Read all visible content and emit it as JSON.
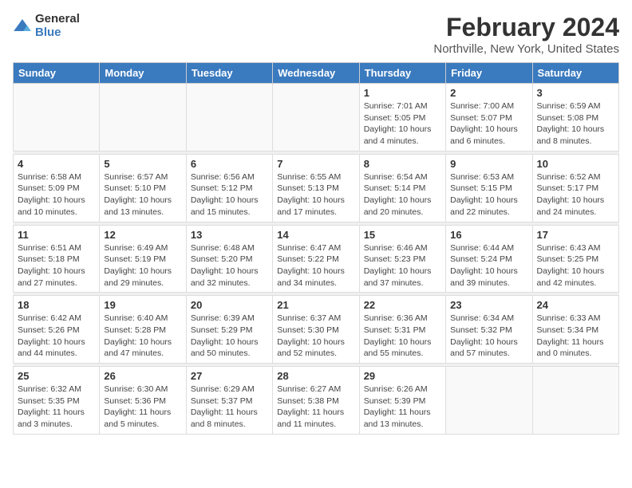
{
  "header": {
    "logo_line1": "General",
    "logo_line2": "Blue",
    "month_title": "February 2024",
    "location": "Northville, New York, United States"
  },
  "weekdays": [
    "Sunday",
    "Monday",
    "Tuesday",
    "Wednesday",
    "Thursday",
    "Friday",
    "Saturday"
  ],
  "weeks": [
    [
      {
        "day": "",
        "info": ""
      },
      {
        "day": "",
        "info": ""
      },
      {
        "day": "",
        "info": ""
      },
      {
        "day": "",
        "info": ""
      },
      {
        "day": "1",
        "info": "Sunrise: 7:01 AM\nSunset: 5:05 PM\nDaylight: 10 hours\nand 4 minutes."
      },
      {
        "day": "2",
        "info": "Sunrise: 7:00 AM\nSunset: 5:07 PM\nDaylight: 10 hours\nand 6 minutes."
      },
      {
        "day": "3",
        "info": "Sunrise: 6:59 AM\nSunset: 5:08 PM\nDaylight: 10 hours\nand 8 minutes."
      }
    ],
    [
      {
        "day": "4",
        "info": "Sunrise: 6:58 AM\nSunset: 5:09 PM\nDaylight: 10 hours\nand 10 minutes."
      },
      {
        "day": "5",
        "info": "Sunrise: 6:57 AM\nSunset: 5:10 PM\nDaylight: 10 hours\nand 13 minutes."
      },
      {
        "day": "6",
        "info": "Sunrise: 6:56 AM\nSunset: 5:12 PM\nDaylight: 10 hours\nand 15 minutes."
      },
      {
        "day": "7",
        "info": "Sunrise: 6:55 AM\nSunset: 5:13 PM\nDaylight: 10 hours\nand 17 minutes."
      },
      {
        "day": "8",
        "info": "Sunrise: 6:54 AM\nSunset: 5:14 PM\nDaylight: 10 hours\nand 20 minutes."
      },
      {
        "day": "9",
        "info": "Sunrise: 6:53 AM\nSunset: 5:15 PM\nDaylight: 10 hours\nand 22 minutes."
      },
      {
        "day": "10",
        "info": "Sunrise: 6:52 AM\nSunset: 5:17 PM\nDaylight: 10 hours\nand 24 minutes."
      }
    ],
    [
      {
        "day": "11",
        "info": "Sunrise: 6:51 AM\nSunset: 5:18 PM\nDaylight: 10 hours\nand 27 minutes."
      },
      {
        "day": "12",
        "info": "Sunrise: 6:49 AM\nSunset: 5:19 PM\nDaylight: 10 hours\nand 29 minutes."
      },
      {
        "day": "13",
        "info": "Sunrise: 6:48 AM\nSunset: 5:20 PM\nDaylight: 10 hours\nand 32 minutes."
      },
      {
        "day": "14",
        "info": "Sunrise: 6:47 AM\nSunset: 5:22 PM\nDaylight: 10 hours\nand 34 minutes."
      },
      {
        "day": "15",
        "info": "Sunrise: 6:46 AM\nSunset: 5:23 PM\nDaylight: 10 hours\nand 37 minutes."
      },
      {
        "day": "16",
        "info": "Sunrise: 6:44 AM\nSunset: 5:24 PM\nDaylight: 10 hours\nand 39 minutes."
      },
      {
        "day": "17",
        "info": "Sunrise: 6:43 AM\nSunset: 5:25 PM\nDaylight: 10 hours\nand 42 minutes."
      }
    ],
    [
      {
        "day": "18",
        "info": "Sunrise: 6:42 AM\nSunset: 5:26 PM\nDaylight: 10 hours\nand 44 minutes."
      },
      {
        "day": "19",
        "info": "Sunrise: 6:40 AM\nSunset: 5:28 PM\nDaylight: 10 hours\nand 47 minutes."
      },
      {
        "day": "20",
        "info": "Sunrise: 6:39 AM\nSunset: 5:29 PM\nDaylight: 10 hours\nand 50 minutes."
      },
      {
        "day": "21",
        "info": "Sunrise: 6:37 AM\nSunset: 5:30 PM\nDaylight: 10 hours\nand 52 minutes."
      },
      {
        "day": "22",
        "info": "Sunrise: 6:36 AM\nSunset: 5:31 PM\nDaylight: 10 hours\nand 55 minutes."
      },
      {
        "day": "23",
        "info": "Sunrise: 6:34 AM\nSunset: 5:32 PM\nDaylight: 10 hours\nand 57 minutes."
      },
      {
        "day": "24",
        "info": "Sunrise: 6:33 AM\nSunset: 5:34 PM\nDaylight: 11 hours\nand 0 minutes."
      }
    ],
    [
      {
        "day": "25",
        "info": "Sunrise: 6:32 AM\nSunset: 5:35 PM\nDaylight: 11 hours\nand 3 minutes."
      },
      {
        "day": "26",
        "info": "Sunrise: 6:30 AM\nSunset: 5:36 PM\nDaylight: 11 hours\nand 5 minutes."
      },
      {
        "day": "27",
        "info": "Sunrise: 6:29 AM\nSunset: 5:37 PM\nDaylight: 11 hours\nand 8 minutes."
      },
      {
        "day": "28",
        "info": "Sunrise: 6:27 AM\nSunset: 5:38 PM\nDaylight: 11 hours\nand 11 minutes."
      },
      {
        "day": "29",
        "info": "Sunrise: 6:26 AM\nSunset: 5:39 PM\nDaylight: 11 hours\nand 13 minutes."
      },
      {
        "day": "",
        "info": ""
      },
      {
        "day": "",
        "info": ""
      }
    ]
  ]
}
